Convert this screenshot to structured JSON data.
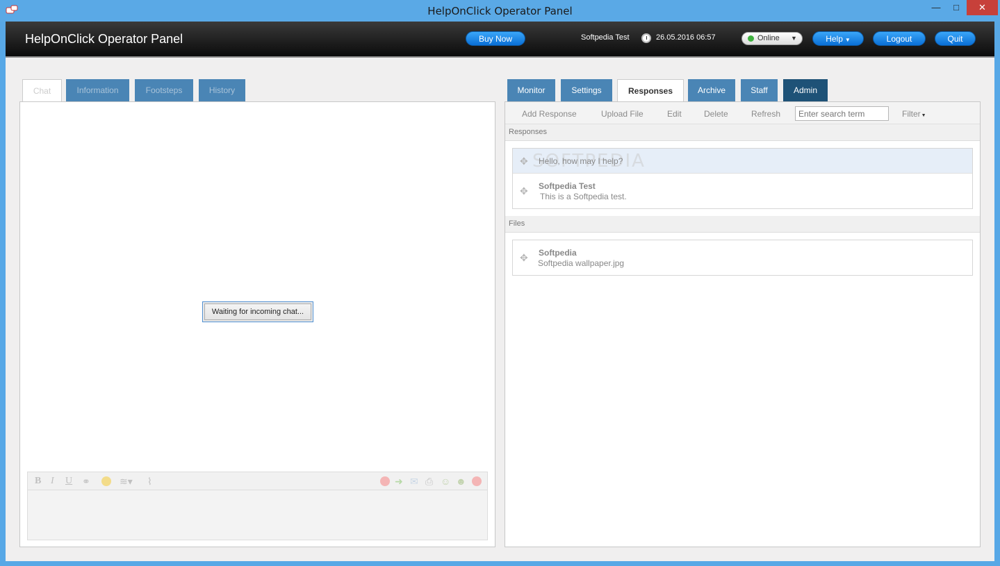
{
  "window": {
    "title": "HelpOnClick Operator Panel",
    "minimize": "—",
    "maximize": "□",
    "close": "✕"
  },
  "header": {
    "brand": "HelpOnClick Operator Panel",
    "buy_now": "Buy Now",
    "user": "Softpedia Test",
    "datetime": "26.05.2016 06:57",
    "status": "Online",
    "help": "Help",
    "logout": "Logout",
    "quit": "Quit"
  },
  "left_tabs": [
    {
      "label": "Chat"
    },
    {
      "label": "Information"
    },
    {
      "label": "Footsteps"
    },
    {
      "label": "History"
    }
  ],
  "chat": {
    "waiting": "Waiting for incoming chat..."
  },
  "editor_tools": {
    "bold": "B",
    "italic": "I",
    "underline": "U"
  },
  "right_tabs": [
    {
      "label": "Monitor"
    },
    {
      "label": "Settings"
    },
    {
      "label": "Responses"
    },
    {
      "label": "Archive"
    },
    {
      "label": "Staff"
    },
    {
      "label": "Admin"
    }
  ],
  "responses_toolbar": {
    "add_response": "Add Response",
    "upload_file": "Upload File",
    "edit": "Edit",
    "delete": "Delete",
    "refresh": "Refresh",
    "search_placeholder": "Enter search term",
    "filter": "Filter"
  },
  "responses_section": {
    "label": "Responses",
    "items": [
      {
        "title": "",
        "text": "Hello, how may I help?"
      },
      {
        "title": "Softpedia Test",
        "text": "This is a Softpedia test."
      }
    ]
  },
  "files_section": {
    "label": "Files",
    "items": [
      {
        "title": "Softpedia",
        "text": "Softpedia wallpaper.jpg"
      }
    ]
  },
  "watermark": "SOFTPEDIA",
  "colors": {
    "tab_blue": "#4a85b5",
    "tab_admin": "#1e5277",
    "button_blue": "#1a8cec",
    "status_online": "#3fb23f"
  }
}
